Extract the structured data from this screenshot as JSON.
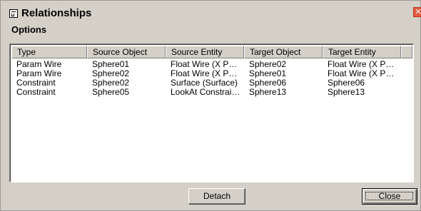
{
  "window": {
    "title": "Relationships",
    "close_symbol": "✕"
  },
  "menu": {
    "options_label": "Options"
  },
  "table": {
    "columns": [
      "Type",
      "Source Object",
      "Source Entity",
      "Target Object",
      "Target Entity"
    ],
    "rows": [
      [
        "Param Wire",
        "Sphere01",
        "Float Wire (X P…",
        "Sphere02",
        "Float Wire (X P…"
      ],
      [
        "Param Wire",
        "Sphere02",
        "Float Wire (X P…",
        "Sphere01",
        "Float Wire (X P…"
      ],
      [
        "Constraint",
        "Sphere02",
        "Surface (Surface)",
        "Sphere06",
        "Sphere06"
      ],
      [
        "Constraint",
        "Sphere05",
        "LookAt Constrai…",
        "Sphere13",
        "Sphere13"
      ]
    ]
  },
  "buttons": {
    "detach_label": "Detach",
    "close_label": "Close"
  },
  "icons": {
    "app": "relationships-window-icon",
    "close": "close-icon"
  }
}
